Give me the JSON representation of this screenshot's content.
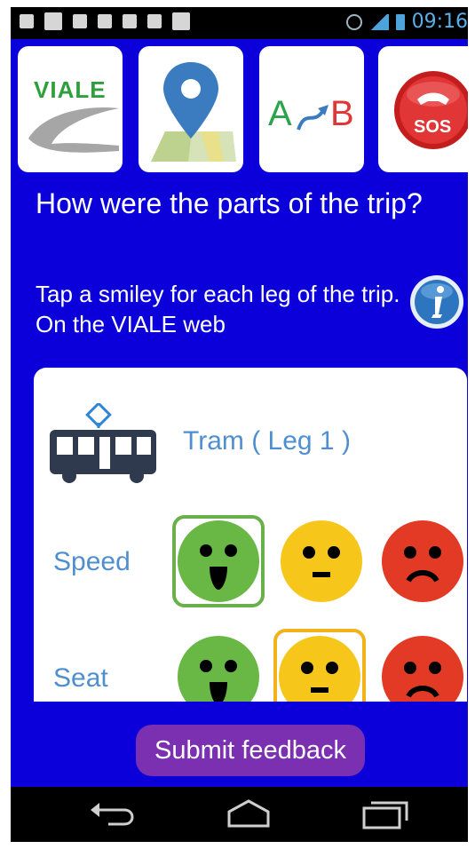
{
  "status_bar": {
    "time": "09:16"
  },
  "toolbar": {
    "viale_logo_text": "VIALE",
    "ab_a": "A",
    "ab_b": "B",
    "sos_text": "SOS"
  },
  "content": {
    "question": "How were the parts of the trip?",
    "instruction": "Tap a smiley for each leg of the trip. On the VIALE web"
  },
  "leg": {
    "label": "Tram ( Leg 1 )",
    "ratings": [
      {
        "label": "Speed",
        "selected": "happy"
      },
      {
        "label": "Seat",
        "selected": "neutral"
      }
    ]
  },
  "actions": {
    "submit_label": "Submit feedback"
  },
  "colors": {
    "background": "#0b00d9",
    "happy": "#69b845",
    "neutral": "#f7c61b",
    "sad": "#e23a25",
    "submit": "#7b2fb1",
    "label_text": "#4f8fcf"
  }
}
